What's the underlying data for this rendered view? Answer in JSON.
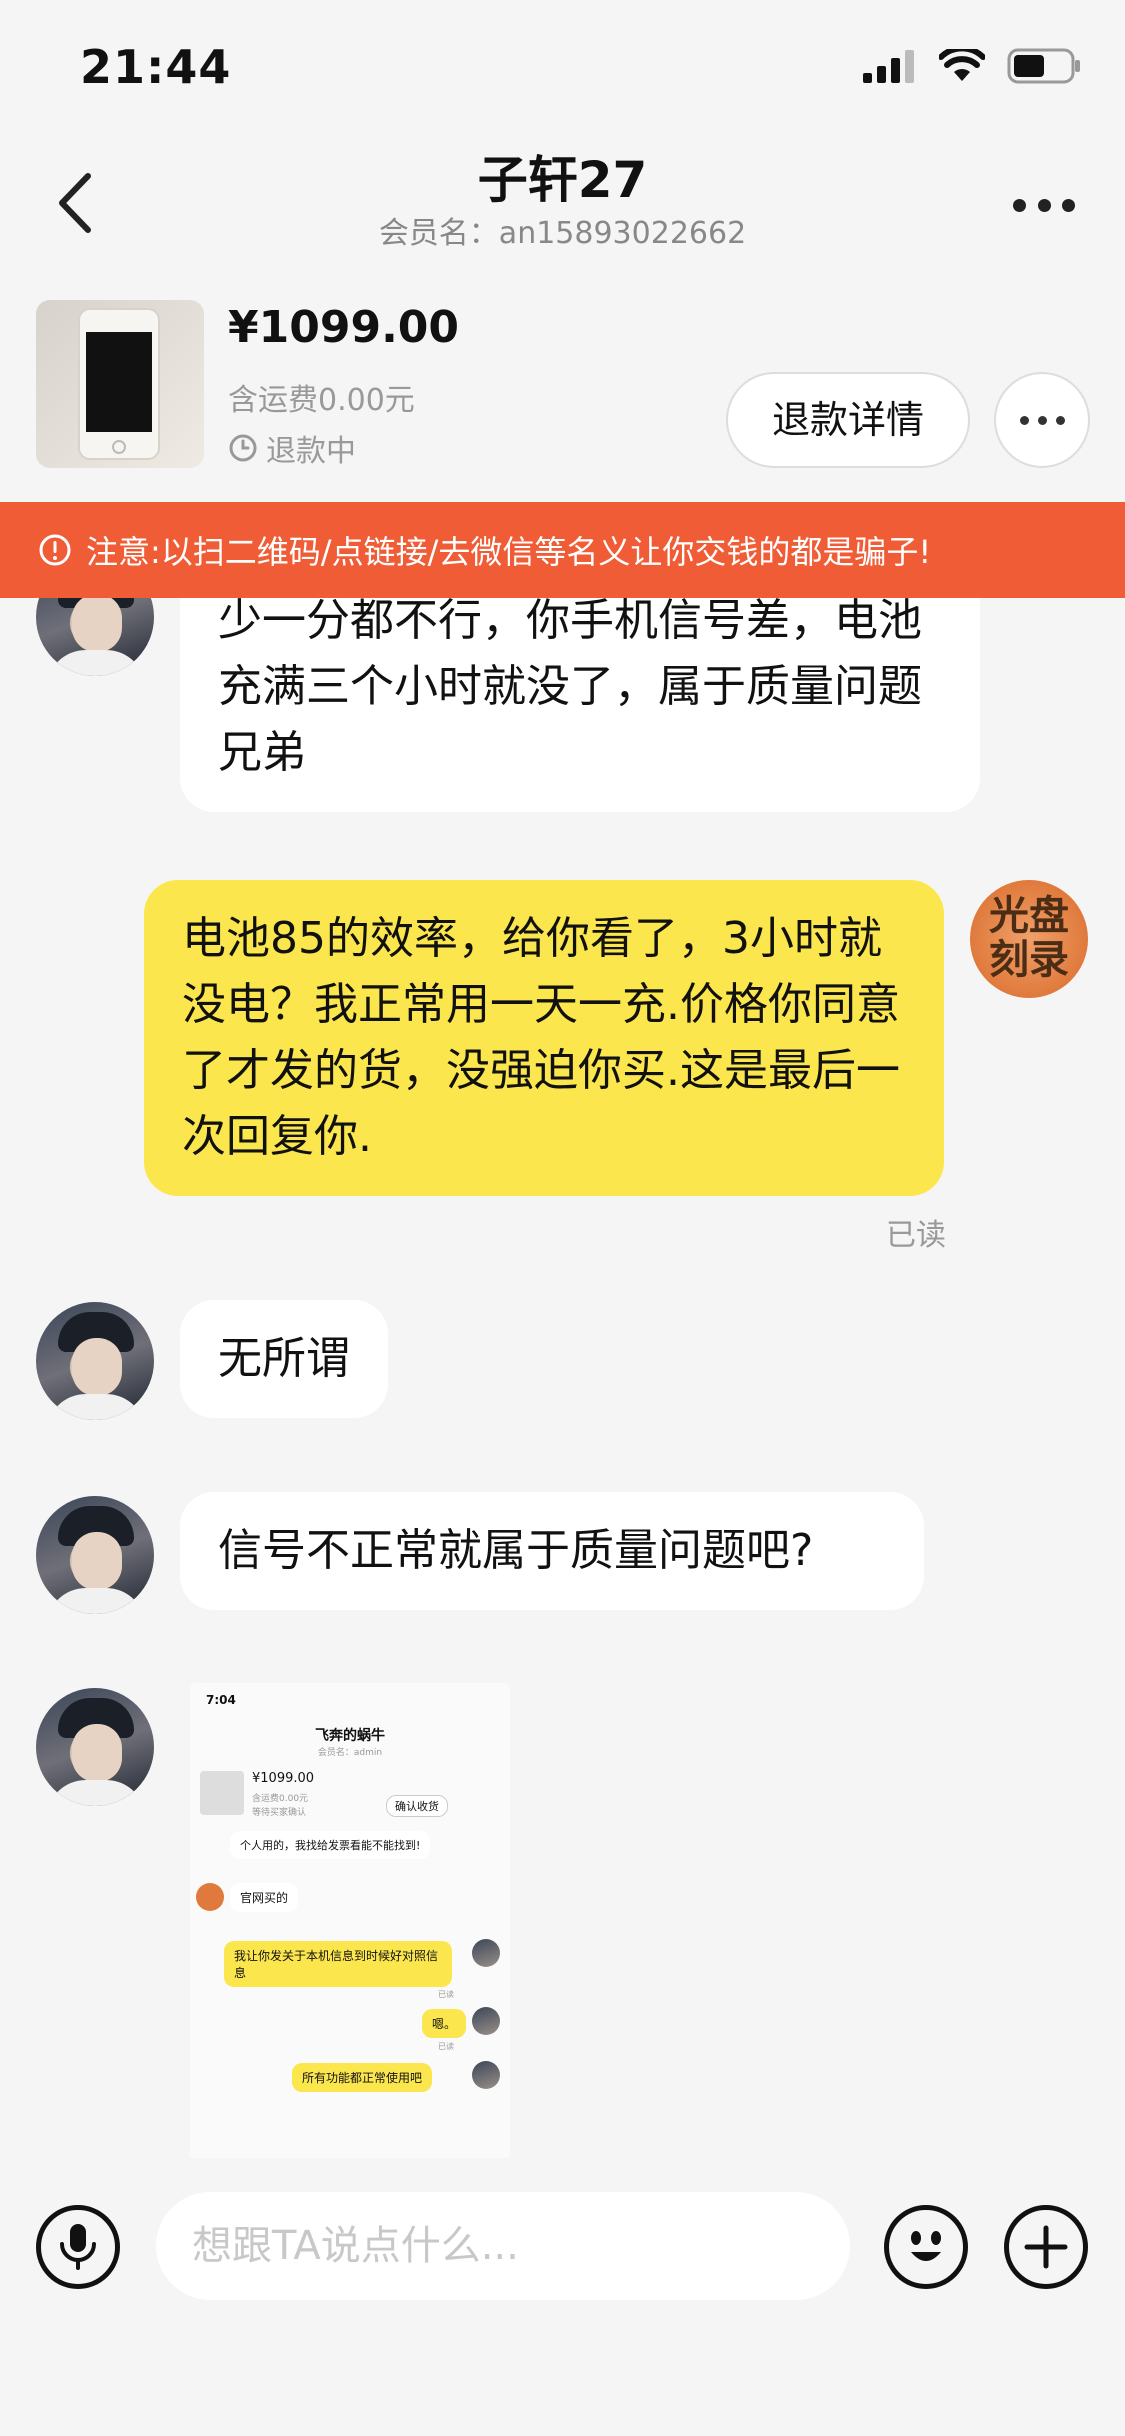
{
  "status_bar": {
    "time": "21:44"
  },
  "nav": {
    "title": "子轩27",
    "subtitle": "会员名：an15893022662"
  },
  "product": {
    "price": "¥1099.00",
    "shipping": "含运费0.00元",
    "status": "退款中",
    "refund_button": "退款详情"
  },
  "warning": {
    "text": "注意:以扫二维码/点链接/去微信等名义让你交钱的都是骗子!"
  },
  "messages": [
    {
      "from": "other",
      "text": "少一分都不行，你手机信号差，电池充满三个小时就没了，属于质量问题兄弟"
    },
    {
      "from": "me",
      "text": "电池85的效率，给你看了，3小时就没电？我正常用一天一充.价格你同意了才发的货，没强迫你买.这是最后一次回复你.",
      "read": "已读"
    },
    {
      "from": "other",
      "text": "无所谓"
    },
    {
      "from": "other",
      "text": "信号不正常就属于质量问题吧?"
    }
  ],
  "my_avatar_text": "光盘刻录",
  "screenshot": {
    "time": "7:04",
    "title": "飞奔的蜗牛",
    "subtitle": "会员名：admin",
    "price": "¥1099.00",
    "shipping": "含运费0.00元",
    "status": "等待买家确认",
    "confirm": "确认收货",
    "msg_top": "个人用的，我找给发票看能不能找到!",
    "msg1": "官网买的",
    "msg2": "我让你发关于本机信息到时候好对照信息",
    "read": "已读",
    "msg3": "嗯。",
    "msg4": "所有功能都正常使用吧"
  },
  "input": {
    "placeholder": "想跟TA说点什么..."
  }
}
